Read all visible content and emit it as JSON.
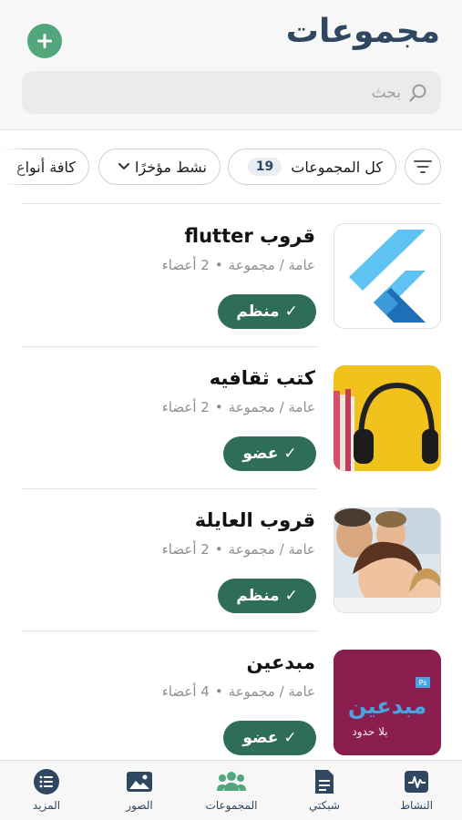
{
  "header": {
    "title": "مجموعات",
    "add_icon": "plus-icon",
    "accent_color": "#51a67c",
    "title_color": "#2f4760"
  },
  "search": {
    "placeholder": "بحث",
    "icon": "search-icon"
  },
  "filters": {
    "icon": "filter-lines-icon",
    "all_groups_label": "كل المجموعات",
    "all_groups_count": "19",
    "recent_label": "نشط مؤخرًا",
    "types_label": "كافة أنواع"
  },
  "groups": [
    {
      "name": "قروب flutter",
      "type": "عامة / مجموعة",
      "members": "2 أعضاء",
      "status": "منظم",
      "image": "flutter-logo"
    },
    {
      "name": "كتب ثقافيه",
      "type": "عامة / مجموعة",
      "members": "2 أعضاء",
      "status": "عضو",
      "image": "headphones-books"
    },
    {
      "name": "قروب العايلة",
      "type": "عامة / مجموعة",
      "members": "2 أعضاء",
      "status": "منظم",
      "image": "family-photo"
    },
    {
      "name": "مبدعين",
      "type": "عامة / مجموعة",
      "members": "4 أعضاء",
      "status": "عضو",
      "image": "mobdeen-logo"
    }
  ],
  "status_badge_color": "#2e6e58",
  "thumbnail_text": {
    "mobdeen_main": "مبدعين",
    "mobdeen_sub": "بلا حدود",
    "mobdeen_badge": "Ps"
  },
  "tabbar": {
    "items": [
      {
        "label": "النشاط",
        "icon": "activity-icon"
      },
      {
        "label": "شبكتي",
        "icon": "document-icon"
      },
      {
        "label": "المجموعات",
        "icon": "groups-icon"
      },
      {
        "label": "الصور",
        "icon": "photos-icon"
      },
      {
        "label": "المزيد",
        "icon": "menu-list-icon"
      }
    ]
  }
}
